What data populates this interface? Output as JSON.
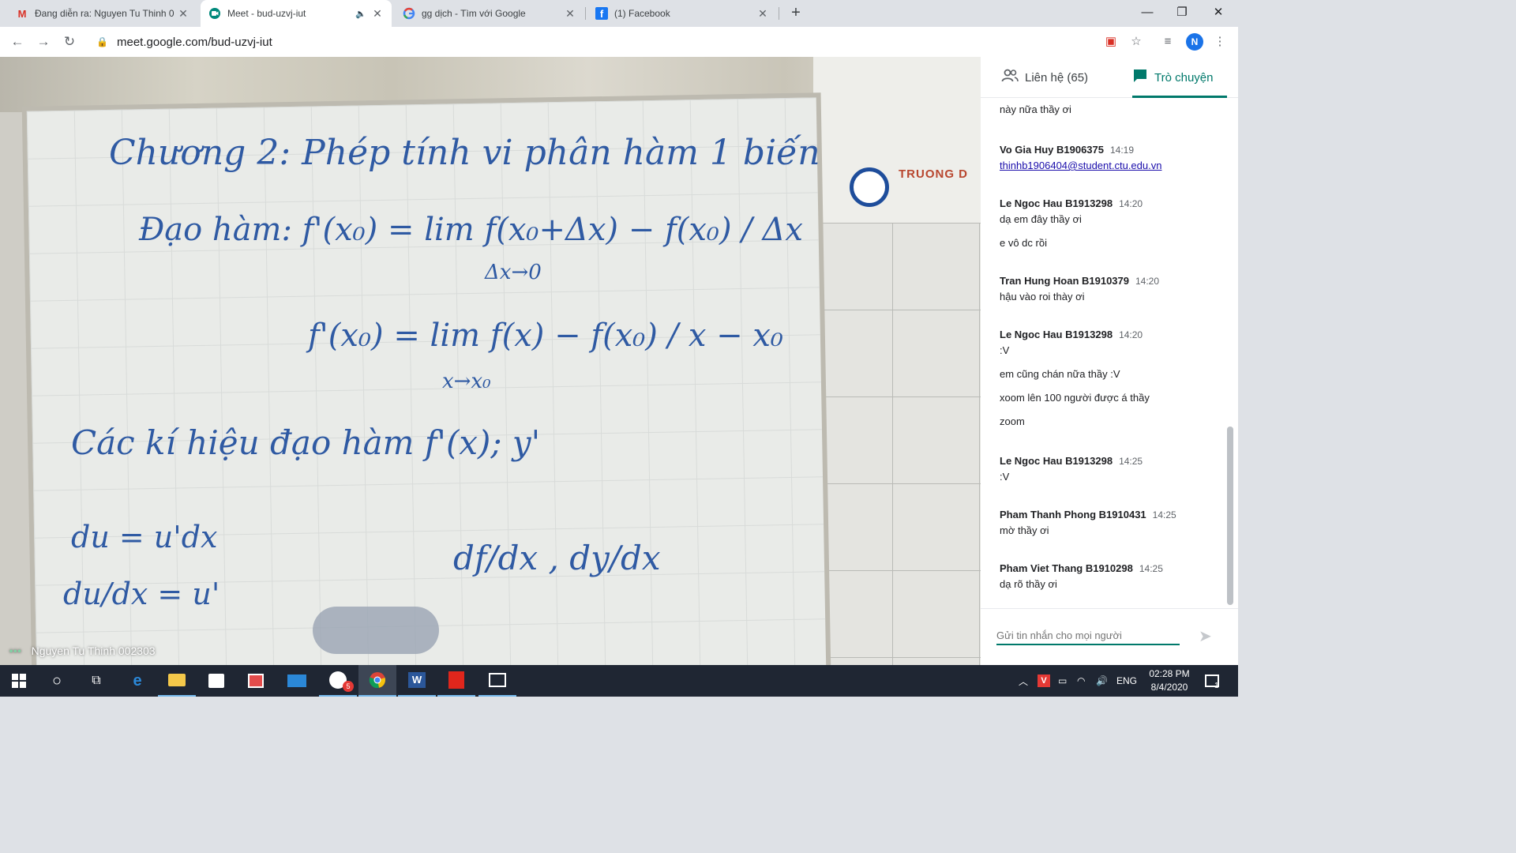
{
  "browser": {
    "tabs": [
      {
        "title": "Đang diễn ra: Nguyen Tu Thinh 0",
        "favicon": "gmail-icon"
      },
      {
        "title": "Meet - bud-uzvj-iut",
        "favicon": "meet-icon"
      },
      {
        "title": "gg dịch - Tìm với Google",
        "favicon": "google-icon"
      },
      {
        "title": "(1) Facebook",
        "favicon": "facebook-icon"
      }
    ],
    "active_tab": 1,
    "url": "meet.google.com/bud-uzvj-iut",
    "profile_initial": "N"
  },
  "video": {
    "presenter_name": "Nguyen Tu Thinh 002303",
    "poster_text": "TRUONG D",
    "board_lines": [
      "Chương 2: Phép tính vi phân hàm 1 biến",
      "Đạo hàm: f'(x₀) = lim f(x₀+Δx) − f(x₀) / Δx",
      "Δx→0",
      "f'(x₀) = lim f(x) − f(x₀) / x − x₀",
      "x→x₀",
      "Các kí hiệu đạo hàm f'(x); y'",
      "du = u'dx",
      "du/dx = u'",
      "df/dx , dy/dx"
    ]
  },
  "panel": {
    "tab_people": "Liên hệ (65)",
    "tab_chat": "Trò chuyện",
    "messages": [
      {
        "sender": "",
        "time": "",
        "lines": [
          "này nữa thầy ơi"
        ]
      },
      {
        "sender": "Vo Gia Huy B1906375",
        "time": "14:19",
        "lines": [
          "thinhb1906404@student.ctu.edu.vn"
        ]
      },
      {
        "sender": "Le Ngoc Hau B1913298",
        "time": "14:20",
        "lines": [
          "dạ em đây thầy ơi",
          "e vô dc rồi"
        ]
      },
      {
        "sender": "Tran Hung Hoan B1910379",
        "time": "14:20",
        "lines": [
          "hậu vào roi thày ơi"
        ]
      },
      {
        "sender": "Le Ngoc Hau B1913298",
        "time": "14:20",
        "lines": [
          ":V",
          "em cũng chán nữa thầy :V",
          "xoom lên 100 người được á thầy",
          "zoom"
        ]
      },
      {
        "sender": "Le Ngoc Hau B1913298",
        "time": "14:25",
        "lines": [
          ":V"
        ]
      },
      {
        "sender": "Pham Thanh Phong B1910431",
        "time": "14:25",
        "lines": [
          "mờ thầy ơi"
        ]
      },
      {
        "sender": "Pham Viet Thang B1910298",
        "time": "14:25",
        "lines": [
          "dạ rõ thầy ơi"
        ]
      }
    ],
    "compose_placeholder": "Gửi tin nhắn cho mọi người"
  },
  "taskbar": {
    "language": "ENG",
    "time": "02:28 PM",
    "date": "8/4/2020",
    "zalo_badge": "5",
    "notification_count": "1"
  },
  "colors": {
    "accent": "#00796b",
    "link": "#1a0dab",
    "taskbar": "#1f2633",
    "marker": "#2f5aa3"
  }
}
